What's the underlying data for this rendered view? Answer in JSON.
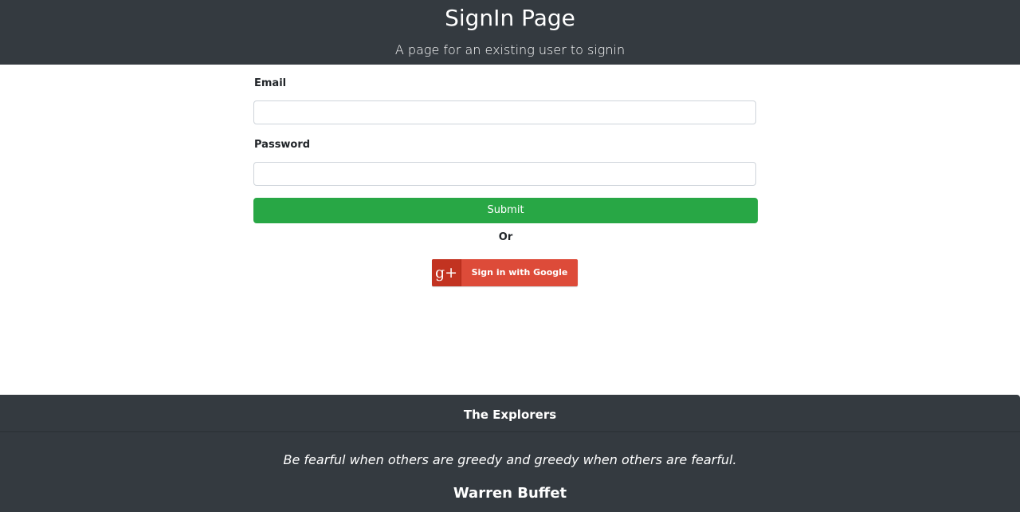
{
  "header": {
    "title": "SignIn Page",
    "subtitle": "A page for an existing user to signin"
  },
  "form": {
    "email_label": "Email",
    "email_value": "",
    "password_label": "Password",
    "password_value": "",
    "submit_label": "Submit",
    "or_text": "Or"
  },
  "google": {
    "icon_glyph": "g+",
    "label": "Sign in with Google",
    "icon": "google-plus-icon"
  },
  "footer": {
    "brand": "The Explorers",
    "quote": "Be fearful when others are greedy and greedy when others are fearful.",
    "author": "Warren Buffet"
  },
  "colors": {
    "header_bg": "#343a40",
    "submit_bg": "#28a745",
    "google_bg": "#dd4b39"
  }
}
